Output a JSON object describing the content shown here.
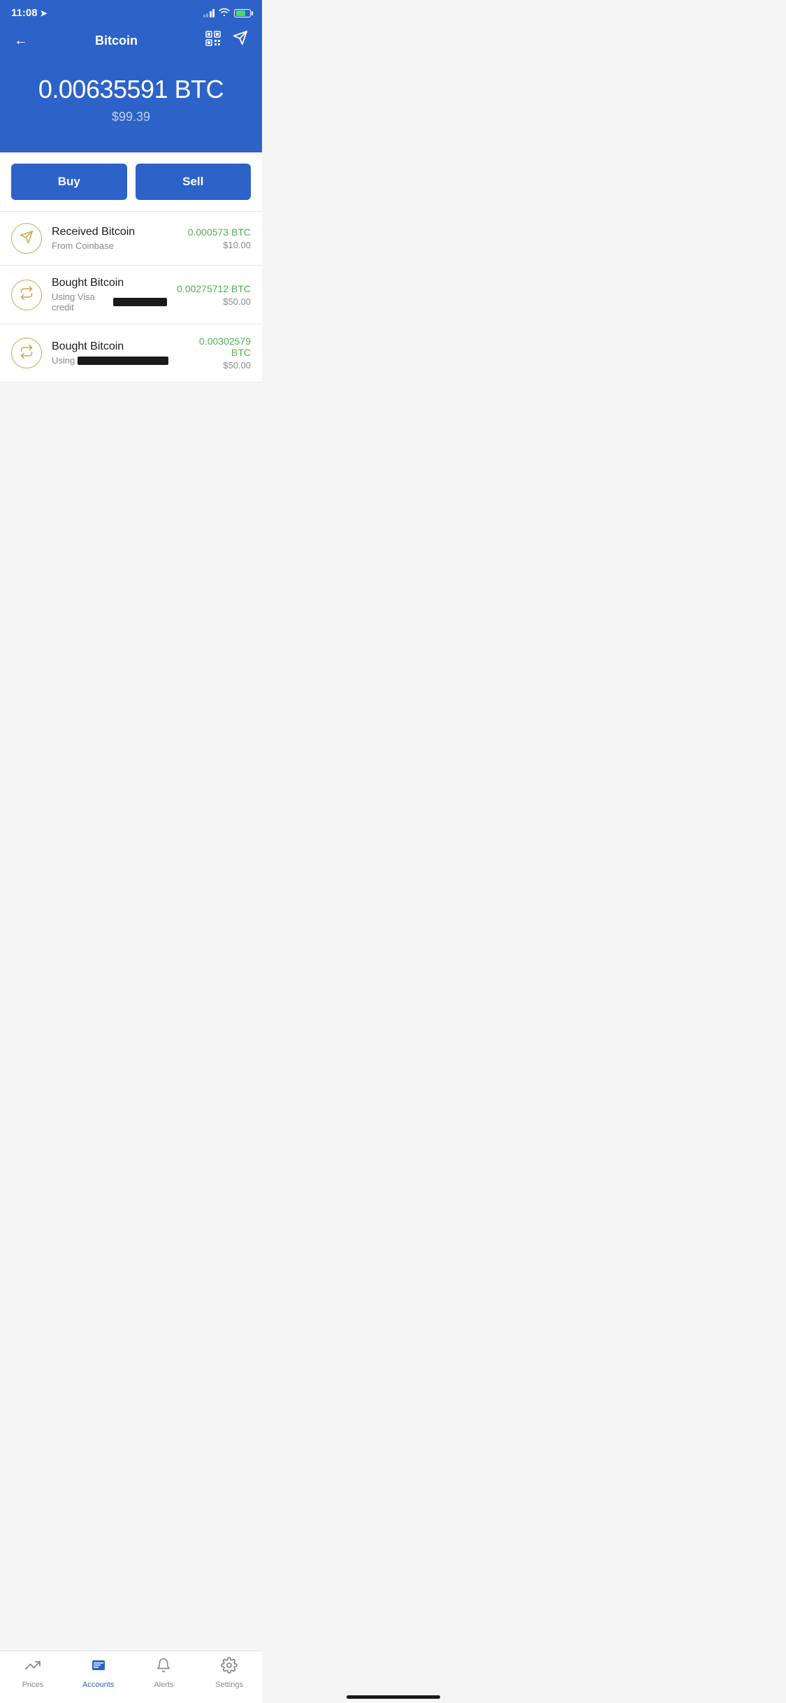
{
  "statusBar": {
    "time": "11:08",
    "location": true
  },
  "header": {
    "title": "Bitcoin",
    "backLabel": "←",
    "qrLabel": "QR",
    "sendLabel": "Send"
  },
  "balance": {
    "btc": "0.00635591 BTC",
    "usd": "$99.39"
  },
  "buttons": {
    "buy": "Buy",
    "sell": "Sell"
  },
  "transactions": [
    {
      "type": "receive",
      "title": "Received Bitcoin",
      "subtitle": "From Coinbase",
      "subtitleRedacted": false,
      "btcAmount": "0.000573 BTC",
      "usdAmount": "$10.00"
    },
    {
      "type": "buy",
      "title": "Bought Bitcoin",
      "subtitle": "Using Visa credit",
      "subtitleRedacted": true,
      "btcAmount": "0.00275712 BTC",
      "usdAmount": "$50.00"
    },
    {
      "type": "buy",
      "title": "Bought Bitcoin",
      "subtitle": "Using",
      "subtitleRedacted": true,
      "btcAmount": "0.00302579 BTC",
      "usdAmount": "$50.00"
    }
  ],
  "bottomNav": [
    {
      "id": "prices",
      "label": "Prices",
      "icon": "prices",
      "active": false
    },
    {
      "id": "accounts",
      "label": "Accounts",
      "icon": "accounts",
      "active": true
    },
    {
      "id": "alerts",
      "label": "Alerts",
      "icon": "alerts",
      "active": false
    },
    {
      "id": "settings",
      "label": "Settings",
      "icon": "settings",
      "active": false
    }
  ]
}
